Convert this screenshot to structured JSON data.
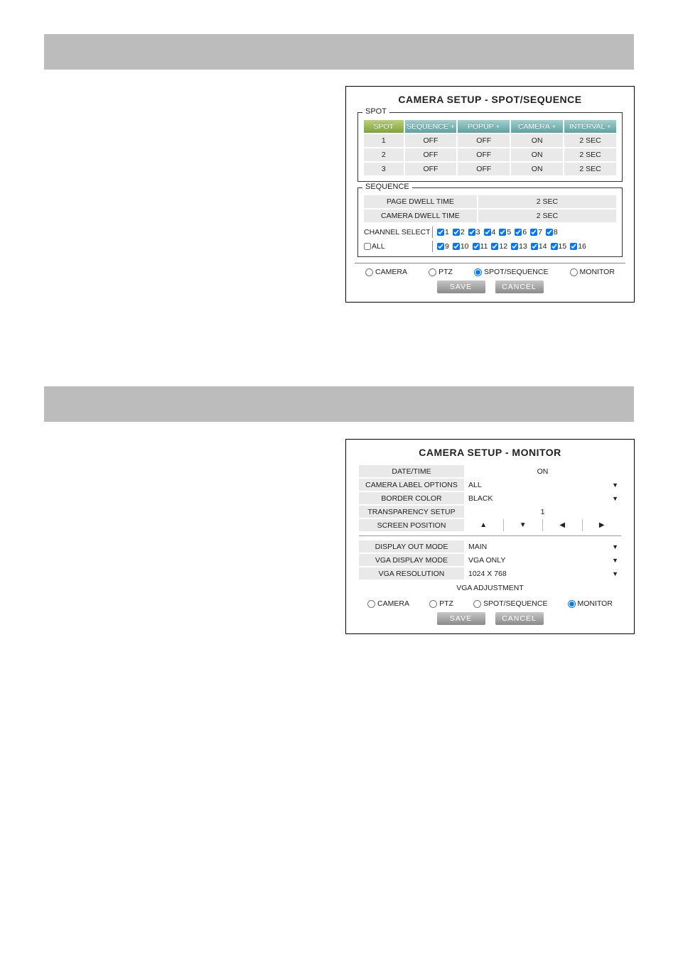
{
  "panel1": {
    "title": "CAMERA SETUP - SPOT/SEQUENCE",
    "spot": {
      "legend": "SPOT",
      "headers": [
        "SPOT",
        "SEQUENCE +",
        "POPUP +",
        "CAMERA +",
        "INTERVAL +"
      ],
      "rows": [
        {
          "id": "1",
          "seq": "OFF",
          "popup": "OFF",
          "camera": "ON",
          "interval": "2 SEC"
        },
        {
          "id": "2",
          "seq": "OFF",
          "popup": "OFF",
          "camera": "ON",
          "interval": "2 SEC"
        },
        {
          "id": "3",
          "seq": "OFF",
          "popup": "OFF",
          "camera": "ON",
          "interval": "2 SEC"
        }
      ]
    },
    "sequence": {
      "legend": "SEQUENCE",
      "page_dwell_label": "PAGE DWELL TIME",
      "page_dwell_value": "2 SEC",
      "camera_dwell_label": "CAMERA DWELL TIME",
      "camera_dwell_value": "2 SEC",
      "channel_select_label": "CHANNEL SELECT",
      "all_label": "ALL",
      "channels": [
        "1",
        "2",
        "3",
        "4",
        "5",
        "6",
        "7",
        "8",
        "9",
        "10",
        "11",
        "12",
        "13",
        "14",
        "15",
        "16"
      ]
    },
    "tabs": {
      "camera": "CAMERA",
      "ptz": "PTZ",
      "spot": "SPOT/SEQUENCE",
      "monitor": "MONITOR"
    },
    "buttons": {
      "save": "SAVE",
      "cancel": "CANCEL"
    }
  },
  "panel2": {
    "title": "CAMERA SETUP - MONITOR",
    "rows": {
      "date_time_label": "DATE/TIME",
      "date_time_value": "ON",
      "camera_label_options_label": "CAMERA LABEL OPTIONS",
      "camera_label_options_value": "ALL",
      "border_color_label": "BORDER COLOR",
      "border_color_value": "BLACK",
      "transparency_label": "TRANSPARENCY SETUP",
      "transparency_value": "1",
      "screen_position_label": "SCREEN POSITION",
      "display_out_label": "DISPLAY OUT MODE",
      "display_out_value": "MAIN",
      "vga_display_label": "VGA DISPLAY MODE",
      "vga_display_value": "VGA ONLY",
      "vga_resolution_label": "VGA RESOLUTION",
      "vga_resolution_value": "1024 X 768",
      "vga_adjustment": "VGA ADJUSTMENT"
    },
    "arrows": {
      "up": "▲",
      "down": "▼",
      "left": "◀",
      "right": "▶"
    },
    "tabs": {
      "camera": "CAMERA",
      "ptz": "PTZ",
      "spot": "SPOT/SEQUENCE",
      "monitor": "MONITOR"
    },
    "buttons": {
      "save": "SAVE",
      "cancel": "CANCEL"
    }
  }
}
